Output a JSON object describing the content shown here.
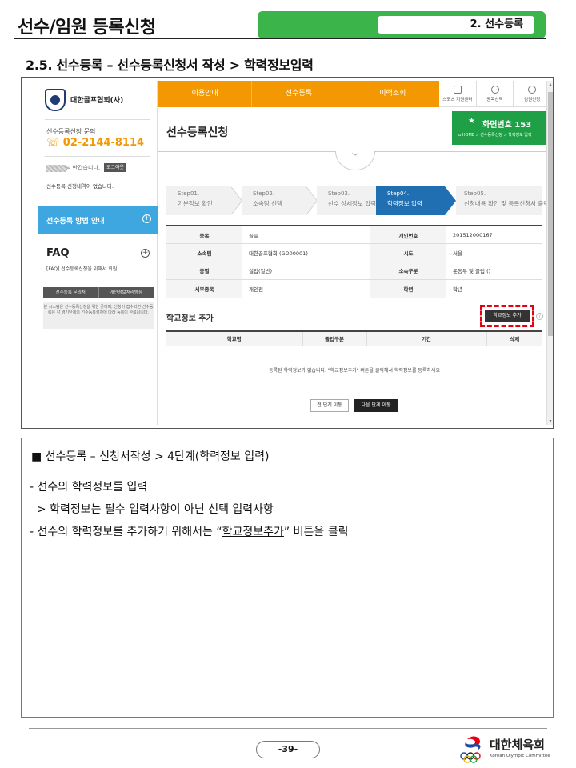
{
  "header": {
    "title": "선수/임원 등록신청",
    "tag": "2. 선수등록"
  },
  "section_heading": "2.5. 선수등록 – 선수등록신청서 작성 > 학력정보입력",
  "screen": {
    "sidebar": {
      "org_name": "대한골프협회(사)",
      "inquiry_label": "선수등록신청 문의",
      "phone": "02-2144-8114",
      "greeting": "님 반갑습니다.",
      "logout": "로그아웃",
      "empty_msg": "선수등록 신청내역이 없습니다.",
      "guide": "선수등록 방법 안내",
      "faq": "FAQ",
      "faq_item": "[FAQ]  선수등록신청을 위해서 회원...",
      "link_inquiry": "선수등록 문의처",
      "link_privacy": "개인정보처리방침",
      "notice": "본 시스템은 선수등록신청을 위한 곳이며, 신청이 접수되면 선수등록은 각 경기단체의 선수등록절차에 따라 등록이 완료됩니다."
    },
    "nav": [
      "이용안내",
      "선수등록",
      "이력조회"
    ],
    "util": [
      "스포츠 지원센터",
      "종목선택",
      "임원신청"
    ],
    "page_title": "선수등록신청",
    "screen_badge": {
      "title": "화면번호 153",
      "crumb": "HOME > 선수등록신청 > 학력정보 입력"
    },
    "steps": [
      {
        "num": "Step01.",
        "label": "기본정보 확인"
      },
      {
        "num": "Step02.",
        "label": "소속팀 선택"
      },
      {
        "num": "Step03.",
        "label": "선수 상세정보 입력"
      },
      {
        "num": "Step04.",
        "label": "학력정보 입력"
      },
      {
        "num": "Step05.",
        "label": "신청내용 확인 및 등록신청서 출력"
      }
    ],
    "info_rows": [
      [
        "종목",
        "골프",
        "개인번호",
        "201512000167"
      ],
      [
        "소속팀",
        "대한골프협회 (GO00001)",
        "시도",
        "서울"
      ],
      [
        "종별",
        "실업(일반)",
        "소속구분",
        "운동부 및 클럽 ()"
      ],
      [
        "세부종목",
        "개인전",
        "학년",
        "학년"
      ]
    ],
    "school_title": "학교정보 추가",
    "add_button": "학교정보 추가",
    "school_cols": [
      "학교명",
      "졸업구분",
      "기간",
      "삭제"
    ],
    "school_empty": "등록된 학력정보가 없습니다. \"학교정보추가\" 버튼을 클릭해서 학력정보를 등록하세요",
    "btn_prev": "전 단계 이동",
    "btn_next": "다음 단계 이동"
  },
  "desc": {
    "title": "■ 선수등록 – 신청서작성 > 4단계(학력정보 입력)",
    "line1": "- 선수의 학력정보를 입력",
    "line2": "  > 학력정보는 필수 입력사항이 아닌 선택 입력사항",
    "line3_pre": "- 선수의 학력정보를 추가하기 위해서는 “",
    "line3_link": "학교정보추가",
    "line3_post": "” 버튼을 클릭"
  },
  "footer": {
    "page": "-39-",
    "logo_name": "대한체육회",
    "logo_sub": "Korean Olympic Committee"
  }
}
